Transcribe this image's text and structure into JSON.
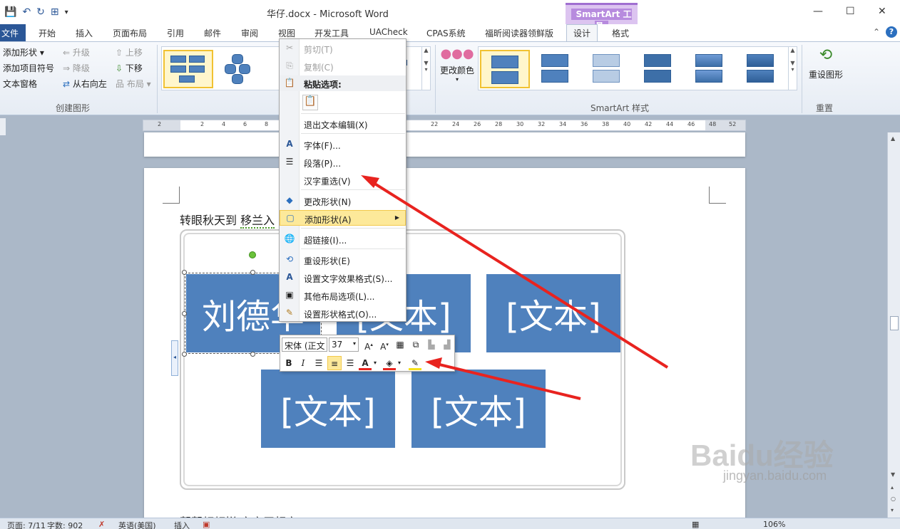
{
  "window": {
    "title": "华仔.docx - Microsoft Word",
    "context_tab_group": "SmartArt 工具",
    "controls": [
      "—",
      "☐",
      "✕"
    ]
  },
  "tabs": {
    "file": "文件",
    "items": [
      "开始",
      "插入",
      "页面布局",
      "引用",
      "邮件",
      "审阅",
      "视图",
      "开发工具",
      "UACheck",
      "CPAS系统",
      "福昕阅读器领鲜版"
    ],
    "active": "设计",
    "format": "格式"
  },
  "ribbon": {
    "create_graphic": {
      "add_shape": "添加形状",
      "add_bullet": "添加项目符号",
      "text_pane": "文本窗格",
      "promote": "升级",
      "demote": "降级",
      "right_to_left": "从右向左",
      "move_up": "上移",
      "move_down": "下移",
      "layout": "布局",
      "group_label": "创建图形"
    },
    "change_colors": "更改颜色",
    "styles_label": "SmartArt 样式",
    "reset_graphic": "重设图形",
    "reset_label": "重置"
  },
  "ruler": {
    "ticks": [
      "2",
      "2",
      "4",
      "6",
      "8",
      "22",
      "24",
      "26",
      "28",
      "30",
      "32",
      "34",
      "36",
      "38",
      "40",
      "42",
      "44",
      "46",
      "48",
      "52"
    ]
  },
  "document": {
    "line1_a": "转眼秋天到",
    "line1_b": "移兰入",
    "bottom_line": "帮帮顿顿拼 亲亲无相亲",
    "boxes": {
      "first": "刘德华",
      "second": "[文本]",
      "third": "[文本]",
      "fourth": "[文本]",
      "fifth": "[文本]"
    }
  },
  "context_menu": {
    "cut": "剪切(T)",
    "copy": "复制(C)",
    "paste_options": "粘贴选项:",
    "exit_edit": "退出文本编辑(X)",
    "font": "字体(F)...",
    "paragraph": "段落(P)...",
    "reconvert": "汉字重选(V)",
    "change_shape": "更改形状(N)",
    "add_shape": "添加形状(A)",
    "hyperlink": "超链接(I)...",
    "reset_shape": "重设形状(E)",
    "text_effects": "设置文字效果格式(S)...",
    "layout_options": "其他布局选项(L)...",
    "shape_format": "设置形状格式(O)..."
  },
  "mini_toolbar": {
    "font": "宋体 (正文",
    "size": "37",
    "bold": "B",
    "italic": "I",
    "font_color_label": "A"
  },
  "status_bar": {
    "page": "页面: 7/11",
    "words": "字数: 902",
    "language": "英语(美国)",
    "mode": "插入",
    "zoom": "106%"
  },
  "watermark": {
    "brand": "Baidu经验",
    "url": "jingyan.baidu.com"
  },
  "colors": {
    "smartart_fill": "#4f81bd",
    "file_tab": "#2b5797",
    "annotation_arrow": "#e8231f",
    "menu_highlight": "#fde99a"
  }
}
